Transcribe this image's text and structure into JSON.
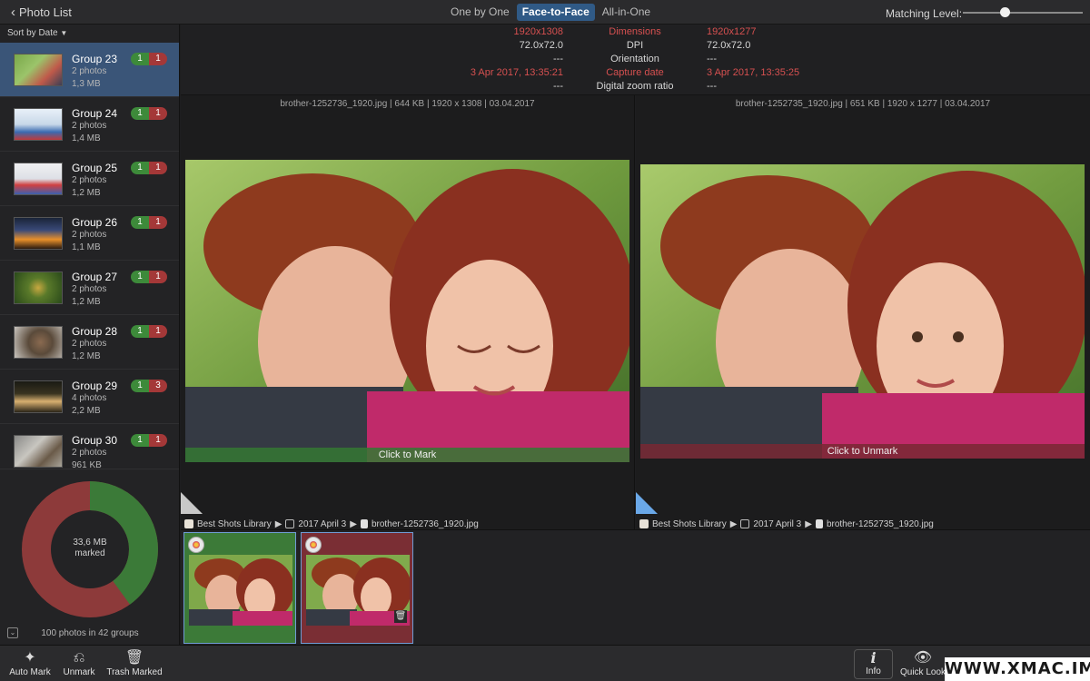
{
  "topbar": {
    "back_label": "Photo List",
    "modes": [
      "One by One",
      "Face-to-Face",
      "All-in-One"
    ],
    "active_mode": "Face-to-Face",
    "matching_label": "Matching Level:",
    "matching_level": 0.35
  },
  "sidebar": {
    "sort_label": "Sort by Date",
    "groups": [
      {
        "name": "Group 23",
        "count": "2 photos",
        "size": "1,3 MB",
        "keep": "1",
        "trash": "1",
        "selected": true
      },
      {
        "name": "Group 24",
        "count": "2 photos",
        "size": "1,4 MB",
        "keep": "1",
        "trash": "1"
      },
      {
        "name": "Group 25",
        "count": "2 photos",
        "size": "1,2 MB",
        "keep": "1",
        "trash": "1"
      },
      {
        "name": "Group 26",
        "count": "2 photos",
        "size": "1,1 MB",
        "keep": "1",
        "trash": "1"
      },
      {
        "name": "Group 27",
        "count": "2 photos",
        "size": "1,2 MB",
        "keep": "1",
        "trash": "1"
      },
      {
        "name": "Group 28",
        "count": "2 photos",
        "size": "1,2 MB",
        "keep": "1",
        "trash": "1"
      },
      {
        "name": "Group 29",
        "count": "4 photos",
        "size": "2,2 MB",
        "keep": "1",
        "trash": "3"
      },
      {
        "name": "Group 30",
        "count": "2 photos",
        "size": "961 KB",
        "keep": "1",
        "trash": "1"
      }
    ],
    "donut_line1": "33,6 MB",
    "donut_line2": "marked",
    "marked_fraction": 0.4,
    "summary": "100 photos in 42 groups"
  },
  "info": {
    "rows": [
      {
        "left": "1920x1308",
        "label": "Dimensions",
        "right": "1920x1277",
        "highlight": true
      },
      {
        "left": "72.0x72.0",
        "label": "DPI",
        "right": "72.0x72.0",
        "highlight": false
      },
      {
        "left": "---",
        "label": "Orientation",
        "right": "---",
        "highlight": false
      },
      {
        "left": "3 Apr 2017, 13:35:21",
        "label": "Capture date",
        "right": "3 Apr 2017, 13:35:25",
        "highlight": true
      },
      {
        "left": "---",
        "label": "Digital zoom ratio",
        "right": "---",
        "highlight": false
      }
    ]
  },
  "left_pane": {
    "filename": "brother-1252736_1920.jpg | 644 KB | 1920 x 1308 | 03.04.2017",
    "mark_label": "Click to Mark",
    "path": [
      "Best Shots Library",
      "2017 April 3",
      "brother-1252736_1920.jpg"
    ]
  },
  "right_pane": {
    "filename": "brother-1252735_1920.jpg | 651 KB | 1920 x 1277 | 03.04.2017",
    "mark_label": "Click to Unmark",
    "path": [
      "Best Shots Library",
      "2017 April 3",
      "brother-1252735_1920.jpg"
    ]
  },
  "bottombar": {
    "auto_mark": "Auto Mark",
    "unmark": "Unmark",
    "trash_marked": "Trash Marked",
    "info": "Info",
    "quick_look": "Quick Look"
  },
  "watermark": "WWW.XMAC.IM",
  "colors": {
    "keep": "#3d8a3a",
    "trash": "#a43838",
    "selection": "#3a5578",
    "accent": "#305a86"
  }
}
